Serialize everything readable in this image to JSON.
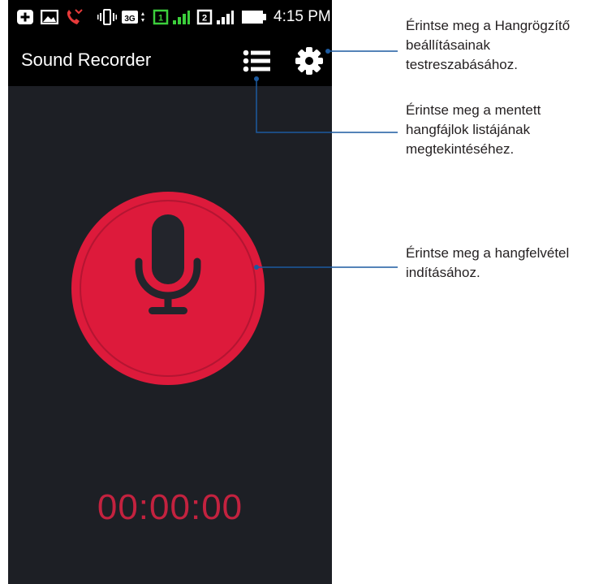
{
  "status_bar": {
    "time": "4:15 PM",
    "icons": [
      "plus-badge-icon",
      "image-icon",
      "missed-call-icon",
      "vibrate-icon",
      "3g-icon",
      "sim1-icon",
      "signal-icon",
      "sim2-icon",
      "signal-icon",
      "battery-icon"
    ],
    "sim1_label": "1",
    "sim2_label": "2",
    "network_label": "3G"
  },
  "app": {
    "title": "Sound Recorder",
    "list_icon": "list-icon",
    "settings_icon": "gear-icon",
    "record_icon": "microphone-icon",
    "timer": "00:00:00"
  },
  "colors": {
    "background": "#1d1f25",
    "record_button": "#dd1a3b",
    "timer": "#c3223f",
    "callout_line": "#1c5aa0"
  },
  "annotations": {
    "settings": "Érintse meg a Hangrögzítő beállításainak testreszabásához.",
    "list": "Érintse meg a mentett hangfájlok listájának megtekintéséhez.",
    "record": "Érintse meg a hangfelvétel indításához."
  }
}
